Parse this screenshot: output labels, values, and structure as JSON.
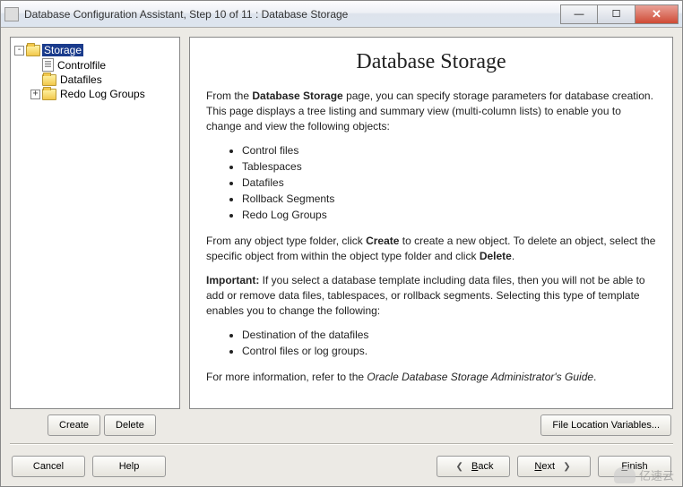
{
  "titlebar": {
    "text": "Database Configuration Assistant, Step 10 of 11 : Database Storage"
  },
  "tree": {
    "root": {
      "label": "Storage"
    },
    "children": {
      "controlfile": "Controlfile",
      "datafiles": "Datafiles",
      "redolog": "Redo Log Groups"
    }
  },
  "content": {
    "heading": "Database Storage",
    "intro": {
      "p1a": "From the ",
      "p1b": "Database Storage",
      "p1c": " page, you can specify storage parameters for database creation. This page displays a tree listing and summary view (multi-column lists) to enable you to change and view the following objects:"
    },
    "list1": [
      "Control files",
      "Tablespaces",
      "Datafiles",
      "Rollback Segments",
      "Redo Log Groups"
    ],
    "para2": {
      "a": "From any object type folder, click ",
      "b": "Create",
      "c": " to create a new object. To delete an object, select the specific object from within the object type folder and click ",
      "d": "Delete",
      "e": "."
    },
    "para3": {
      "a": "Important:",
      "b": " If you select a database template including data files, then you will not be able to add or remove data files, tablespaces, or rollback segments. Selecting this type of template enables you to change the following:"
    },
    "list2": [
      "Destination of the datafiles",
      "Control files or log groups."
    ],
    "para4": {
      "a": "For more information, refer to the ",
      "b": "Oracle Database Storage Administrator's Guide",
      "c": "."
    }
  },
  "buttons": {
    "create": "Create",
    "delete": "Delete",
    "file_loc": "File Location Variables...",
    "cancel": "Cancel",
    "help": "Help",
    "back": "ack",
    "next": "ext",
    "finish": "inish"
  },
  "watermark": "亿速云"
}
